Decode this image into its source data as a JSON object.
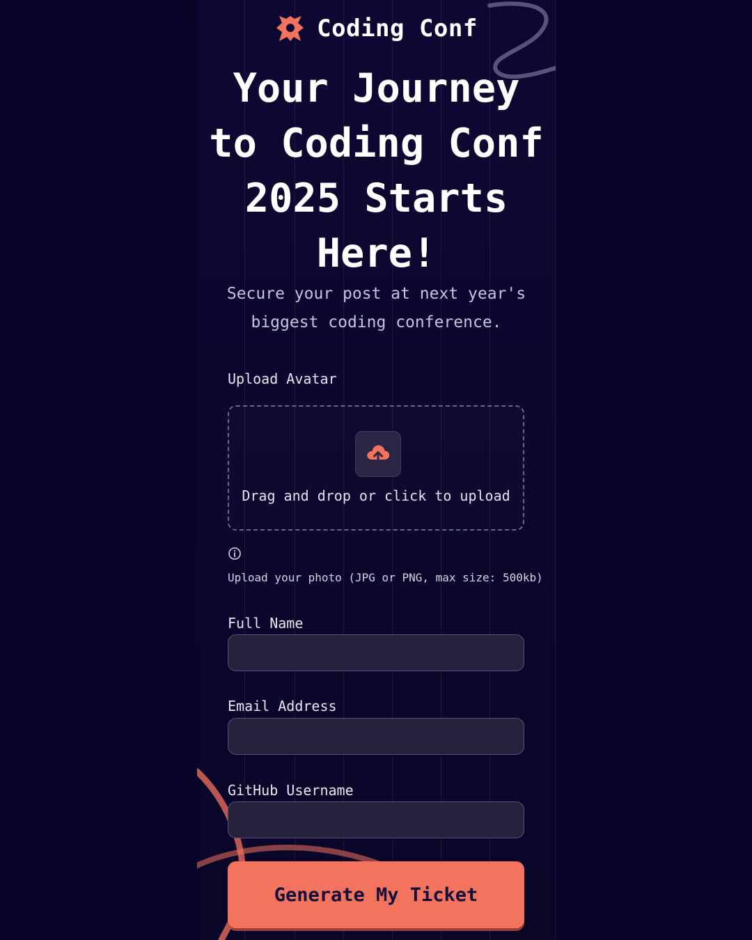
{
  "brand": {
    "name": "Coding Conf",
    "accent_color": "#f4735e",
    "background_color": "#0d0833"
  },
  "hero": {
    "headline": "Your Journey to Coding Conf 2025 Starts Here!",
    "subtitle": "Secure your post at next year's biggest coding conference."
  },
  "avatar": {
    "label": "Upload Avatar",
    "dropzone_text": "Drag and drop or click to upload",
    "upload_icon": "cloud-upload-icon",
    "hint_icon": "info-icon",
    "hint": "Upload your photo (JPG or PNG, max size: 500kb)"
  },
  "form": {
    "full_name": {
      "label": "Full Name",
      "value": ""
    },
    "email": {
      "label": "Email Address",
      "value": ""
    },
    "github": {
      "label": "GitHub Username",
      "value": ""
    },
    "submit_label": "Generate My Ticket"
  }
}
